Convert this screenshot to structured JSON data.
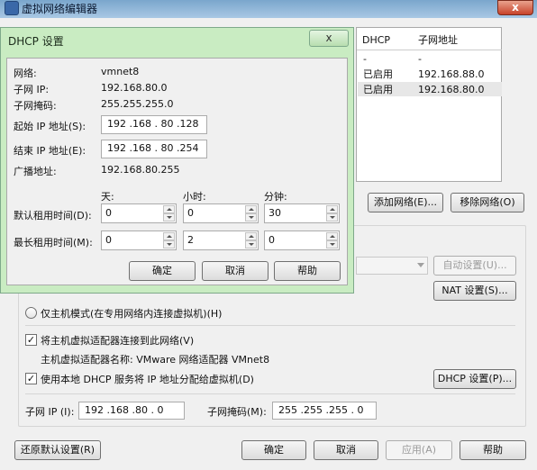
{
  "main_window": {
    "title": "虚拟网络编辑器",
    "close_glyph": "x",
    "table": {
      "headers": [
        "DHCP",
        "子网地址"
      ],
      "rows": [
        {
          "dhcp": "-",
          "subnet": "-"
        },
        {
          "dhcp": "已启用",
          "subnet": "192.168.88.0"
        },
        {
          "dhcp": "已启用",
          "subnet": "192.168.80.0"
        }
      ]
    },
    "add_network_label": "添加网络(E)...",
    "remove_network_label": "移除网络(O)",
    "auto_settings_label": "自动设置(U)...",
    "nat_settings_label": "NAT 设置(S)...",
    "host_only_label": "仅主机模式(在专用网络内连接虚拟机)(H)",
    "connect_adapter_label": "将主机虚拟适配器连接到此网络(V)",
    "adapter_name_label": "主机虚拟适配器名称: VMware 网络适配器 VMnet8",
    "use_dhcp_label": "使用本地 DHCP 服务将 IP 地址分配给虚拟机(D)",
    "dhcp_settings_label": "DHCP 设置(P)...",
    "subnet_ip_label": "子网 IP (I):",
    "subnet_ip_value": "192 .168 .80 . 0",
    "subnet_mask_label": "子网掩码(M):",
    "subnet_mask_value": "255 .255 .255 . 0",
    "restore_defaults_label": "还原默认设置(R)",
    "ok_label": "确定",
    "cancel_label": "取消",
    "apply_label": "应用(A)",
    "help_label": "帮助"
  },
  "dhcp_dialog": {
    "title": "DHCP 设置",
    "close_glyph": "x",
    "network_label": "网络:",
    "network_value": "vmnet8",
    "subnet_ip_label": "子网 IP:",
    "subnet_ip_value": "192.168.80.0",
    "subnet_mask_label": "子网掩码:",
    "subnet_mask_value": "255.255.255.0",
    "start_ip_label": "起始 IP 地址(S):",
    "start_ip_value": "192 .168 . 80 .128",
    "end_ip_label": "结束 IP 地址(E):",
    "end_ip_value": "192 .168 . 80 .254",
    "broadcast_label": "广播地址:",
    "broadcast_value": "192.168.80.255",
    "days_header": "天:",
    "hours_header": "小时:",
    "minutes_header": "分钟:",
    "default_lease_label": "默认租用时间(D):",
    "default_lease": {
      "days": "0",
      "hours": "0",
      "minutes": "30"
    },
    "max_lease_label": "最长租用时间(M):",
    "max_lease": {
      "days": "0",
      "hours": "2",
      "minutes": "0"
    },
    "ok_label": "确定",
    "cancel_label": "取消",
    "help_label": "帮助"
  }
}
